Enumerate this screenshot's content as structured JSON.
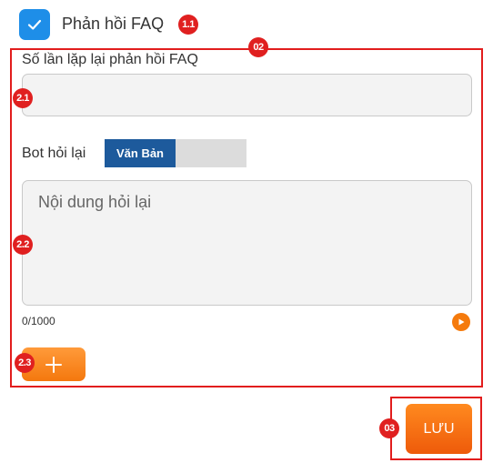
{
  "faq": {
    "checked": true,
    "title": "Phản hồi FAQ",
    "badge": "1.1"
  },
  "section": {
    "badge": "02",
    "repeat_label": "Số lần lặp lại phản hồi FAQ",
    "repeat_badge": "2.1",
    "bot_label": "Bot hỏi lại",
    "toggle_active": "Văn Bản",
    "textarea_placeholder": "Nội dung hỏi lại",
    "textarea_badge": "2.2",
    "char_counter": "0/1000",
    "add_badge": "2.3",
    "add_icon": "plus-icon",
    "play_icon": "play-icon"
  },
  "save": {
    "label": "LƯU",
    "badge": "03"
  },
  "colors": {
    "annotation_red": "#e21d1d",
    "checkbox_blue": "#1e8ee8",
    "toggle_navy": "#1d5a9c",
    "accent_orange": "#f57a0c"
  }
}
